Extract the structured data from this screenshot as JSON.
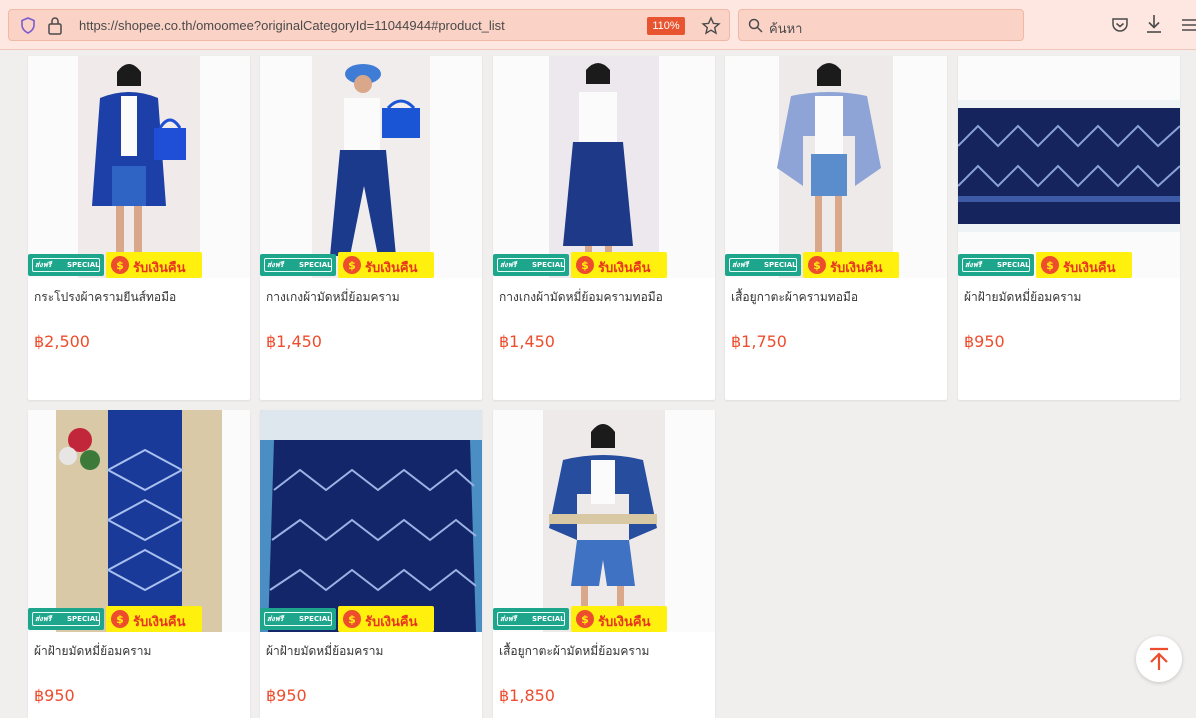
{
  "browser": {
    "url": "https://shopee.co.th/omoomee?originalCategoryId=11044944#product_list",
    "zoom": "110%",
    "search_placeholder": "ค้นหา"
  },
  "badges": {
    "free_shipping_left": "ส่งฟรี",
    "free_shipping_right": "SPECIAL",
    "cashback": "รับเงินคืน"
  },
  "products": [
    {
      "title": "กระโปรงผ้าครามยีนส์ทอมือ",
      "price": "฿2,500"
    },
    {
      "title": "กางเกงผ้ามัดหมี่ย้อมคราม",
      "price": "฿1,450"
    },
    {
      "title": "กางเกงผ้ามัดหมี่ย้อมครามทอมือ",
      "price": "฿1,450"
    },
    {
      "title": "เสื้อยูกาตะผ้าครามทอมือ",
      "price": "฿1,750"
    },
    {
      "title": "ผ้าฝ้ายมัดหมี่ย้อมคราม",
      "price": "฿950"
    },
    {
      "title": "ผ้าฝ้ายมัดหมี่ย้อมคราม",
      "price": "฿950"
    },
    {
      "title": "ผ้าฝ้ายมัดหมี่ย้อมคราม",
      "price": "฿950"
    },
    {
      "title": "เสื้อยูกาตะผ้ามัดหมี่ย้อมคราม",
      "price": "฿1,850"
    }
  ],
  "colors": {
    "price": "#ee4d2d",
    "toolbar": "#fde7e0",
    "cashback_bg": "#fff00e",
    "free_ship_bg": "#1ea68d"
  }
}
